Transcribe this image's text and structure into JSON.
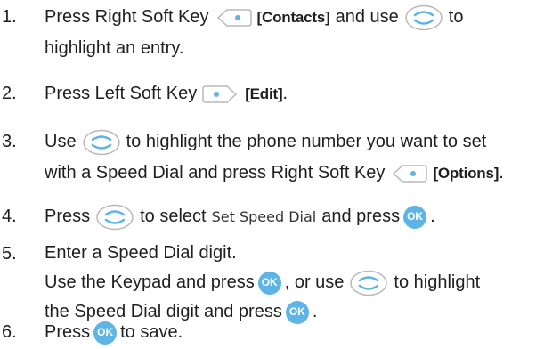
{
  "steps": [
    {
      "number": "1.",
      "lines": [
        [
          "Press Right Soft Key",
          "[Contacts]",
          "and use",
          "to"
        ],
        [
          "highlight an entry."
        ]
      ]
    },
    {
      "number": "2.",
      "lines": [
        [
          "Press Left Soft Key",
          "[Edit]",
          "."
        ]
      ]
    },
    {
      "number": "3.",
      "lines": [
        [
          "Use",
          "to highlight the phone number you want to set"
        ],
        [
          "with a Speed Dial and press Right Soft Key",
          "[Options]",
          "."
        ]
      ]
    },
    {
      "number": "4.",
      "lines": [
        [
          "Press",
          "to select",
          "Set Speed Dial",
          "and press",
          "."
        ]
      ]
    },
    {
      "number": "5.",
      "lines": [
        [
          "Enter a Speed Dial digit."
        ],
        [
          "Use the Keypad and press",
          ", or use",
          "to highlight"
        ],
        [
          "the Speed Dial digit and press",
          "."
        ]
      ]
    },
    {
      "number": "6.",
      "lines": [
        [
          "Press",
          "to save."
        ]
      ]
    }
  ],
  "ok_label": "OK",
  "colors": {
    "ok_button": "#5fb4e6",
    "text": "#1f1f1f",
    "icon_accent": "#5fb4e6"
  }
}
